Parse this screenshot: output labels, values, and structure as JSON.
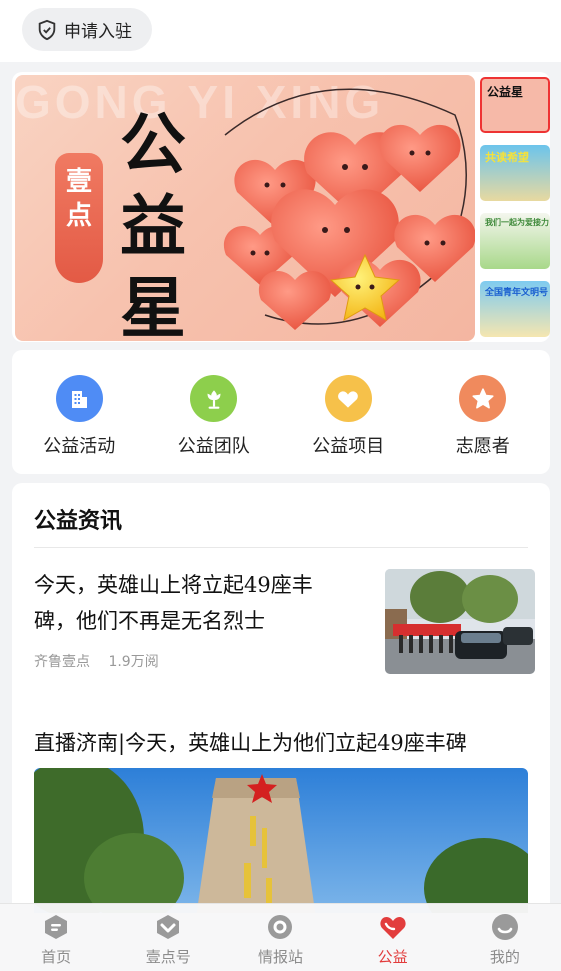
{
  "header": {
    "apply_label": "申请入驻"
  },
  "banner": {
    "bg_text": "GONG YI XING",
    "tag": [
      "壹",
      "点"
    ],
    "title": [
      "公",
      "益",
      "星"
    ],
    "thumbs": [
      {
        "label": "公益星",
        "bg": "#f6b9a8",
        "active": true
      },
      {
        "label": "共读希望",
        "bg": "#7ecbe8",
        "active": false
      },
      {
        "label": "我们一起为爱接力",
        "bg": "#cfe7c8",
        "active": false
      },
      {
        "label": "全国青年文明号",
        "bg": "#8ed0ee",
        "active": false
      }
    ]
  },
  "categories": [
    {
      "label": "公益活动",
      "icon": "building-icon",
      "color": "#4f8cf5"
    },
    {
      "label": "公益团队",
      "icon": "flower-icon",
      "color": "#8dcf4c"
    },
    {
      "label": "公益项目",
      "icon": "heart-icon",
      "color": "#f6c14a"
    },
    {
      "label": "志愿者",
      "icon": "star-icon",
      "color": "#f08a5d"
    }
  ],
  "news": {
    "header": "公益资讯",
    "articles": [
      {
        "title": "今天，英雄山上将立起49座丰碑，他们不再是无名烈士",
        "source": "齐鲁壹点",
        "views": "1.9万阅"
      },
      {
        "title": "直播济南|今天，英雄山上为他们立起49座丰碑"
      }
    ]
  },
  "nav": [
    {
      "label": "首页",
      "icon": "home-icon",
      "active": false
    },
    {
      "label": "壹点号",
      "icon": "yidian-icon",
      "active": false
    },
    {
      "label": "情报站",
      "icon": "intel-icon",
      "active": false
    },
    {
      "label": "公益",
      "icon": "charity-heart-icon",
      "active": true
    },
    {
      "label": "我的",
      "icon": "profile-icon",
      "active": false
    }
  ],
  "colors": {
    "accent": "#e23d3d",
    "inactive": "#8c8c8c"
  }
}
